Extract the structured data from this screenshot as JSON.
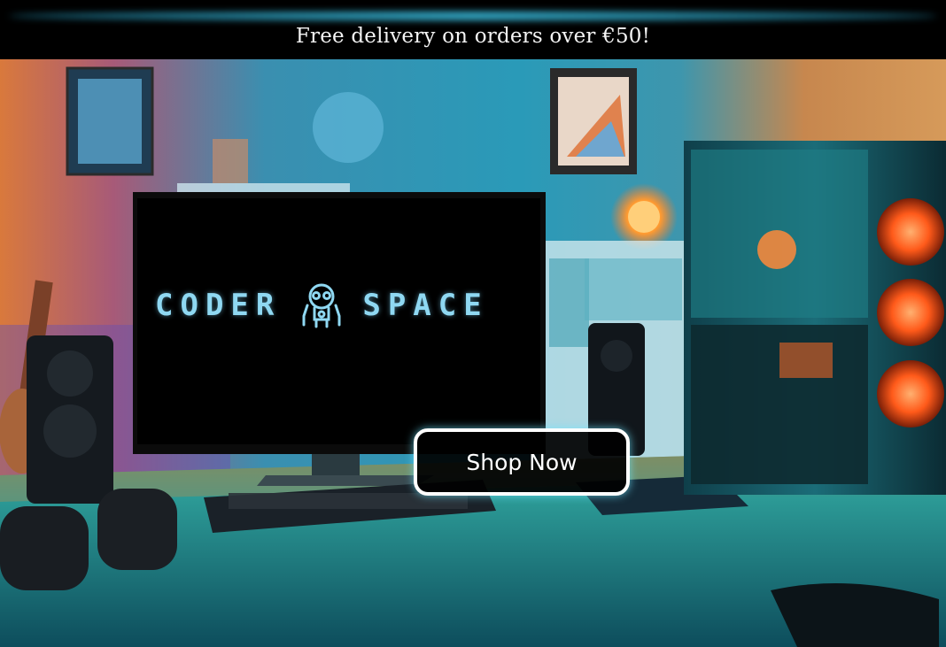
{
  "banner": {
    "text": "Free delivery on orders over €50!"
  },
  "hero": {
    "logo_left": "CODER",
    "logo_right": "SPACE",
    "cta_label": "Shop Now"
  },
  "colors": {
    "banner_bg": "#000000",
    "banner_glow": "#3cc8eb",
    "logo_cyan": "#8fd8f2",
    "button_bg": "#000000",
    "button_border": "#ffffff"
  },
  "icons": [
    "robot-icon"
  ]
}
